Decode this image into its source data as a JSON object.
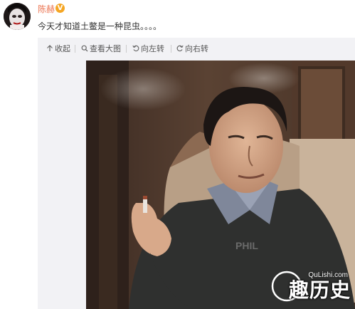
{
  "post": {
    "user_name": "陈赫",
    "verified_mark": "V",
    "text": "今天才知道土鳖是一种昆虫。。。。",
    "avatar_icon": "avatar-face"
  },
  "toolbar": {
    "collapse_label": "收起",
    "view_large_label": "查看大图",
    "rotate_left_label": "向左转",
    "rotate_right_label": "向右转",
    "collapse_icon": "arrow-up-icon",
    "view_large_icon": "magnifier-icon",
    "rotate_left_icon": "rotate-left-icon",
    "rotate_right_icon": "rotate-right-icon"
  },
  "watermark": {
    "site": "QuLishi.com",
    "brand": "趣历史"
  },
  "colors": {
    "name": "#eb7350",
    "verified": "#f5a623",
    "card_background": "#f2f2f5",
    "text": "#333333"
  }
}
